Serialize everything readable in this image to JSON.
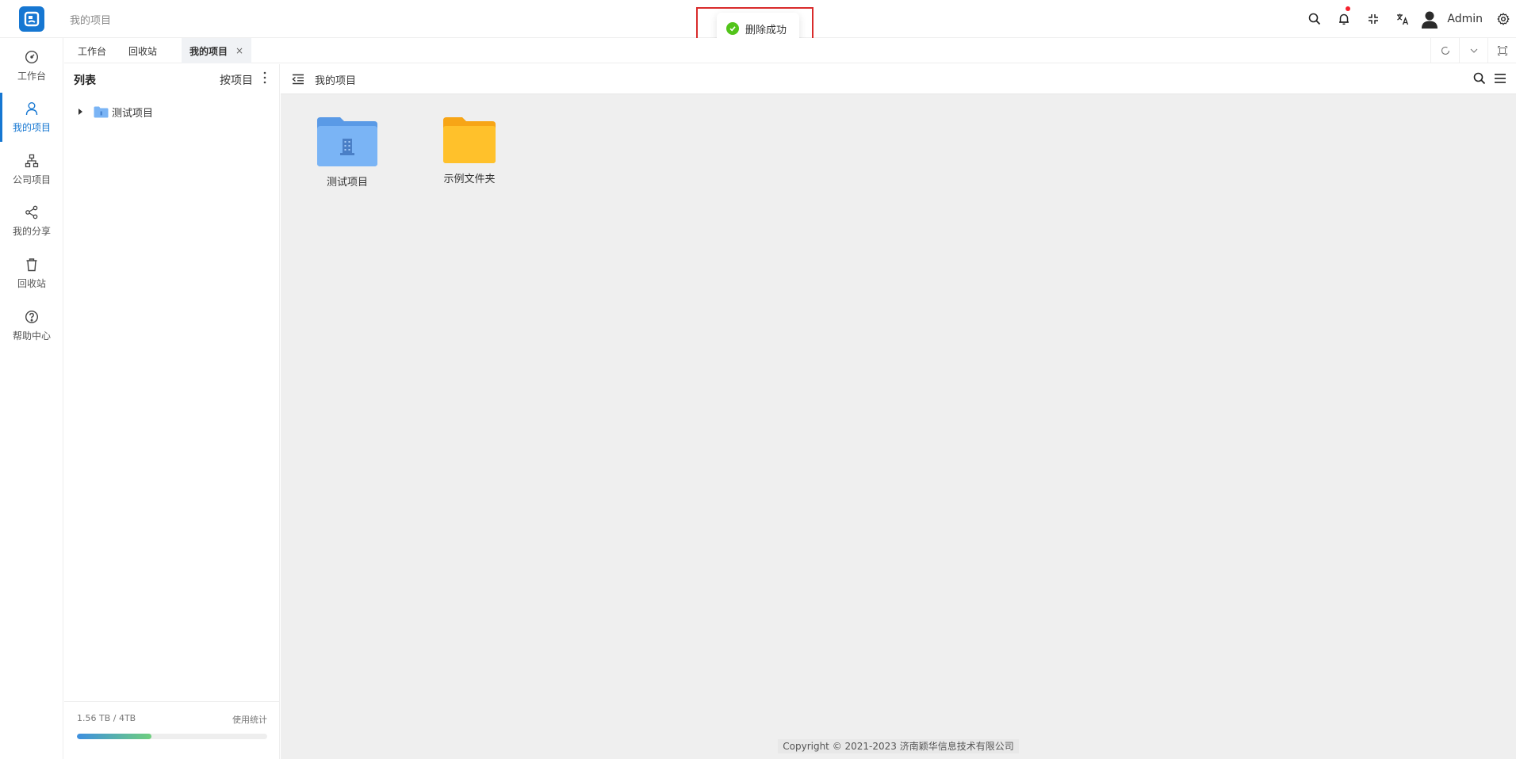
{
  "header": {
    "breadcrumb": "我的项目",
    "username": "Admin",
    "icons": [
      "search-icon",
      "bell-icon",
      "fullscreen-icon",
      "translate-icon",
      "avatar",
      "settings-icon"
    ]
  },
  "toast": {
    "message": "删除成功",
    "type": "success"
  },
  "nav": {
    "items": [
      {
        "label": "工作台",
        "icon": "dashboard-icon"
      },
      {
        "label": "我的项目",
        "icon": "user-icon",
        "active": true
      },
      {
        "label": "公司项目",
        "icon": "org-icon"
      },
      {
        "label": "我的分享",
        "icon": "share-icon"
      },
      {
        "label": "回收站",
        "icon": "trash-icon"
      },
      {
        "label": "帮助中心",
        "icon": "help-icon"
      }
    ]
  },
  "tabs": {
    "items": [
      {
        "label": "工作台"
      },
      {
        "label": "回收站"
      },
      {
        "label": "我的项目",
        "active": true,
        "close": "×"
      }
    ]
  },
  "tree": {
    "title": "列表",
    "sort_label": "按项目",
    "nodes": [
      {
        "label": "测试项目"
      }
    ],
    "usage": {
      "text": "1.56 TB / 4TB",
      "link": "使用统计",
      "fraction": 0.39
    }
  },
  "main": {
    "title": "我的项目",
    "files": [
      {
        "label": "测试项目",
        "kind": "project-folder"
      },
      {
        "label": "示例文件夹",
        "kind": "folder"
      }
    ],
    "copyright": "Copyright © 2021-2023 济南颖华信息技术有限公司"
  },
  "colors": {
    "accent": "#1677d2",
    "success": "#52c41a",
    "folder_yellow": "#ffc12b",
    "project_blue": "#7ab4f5"
  }
}
